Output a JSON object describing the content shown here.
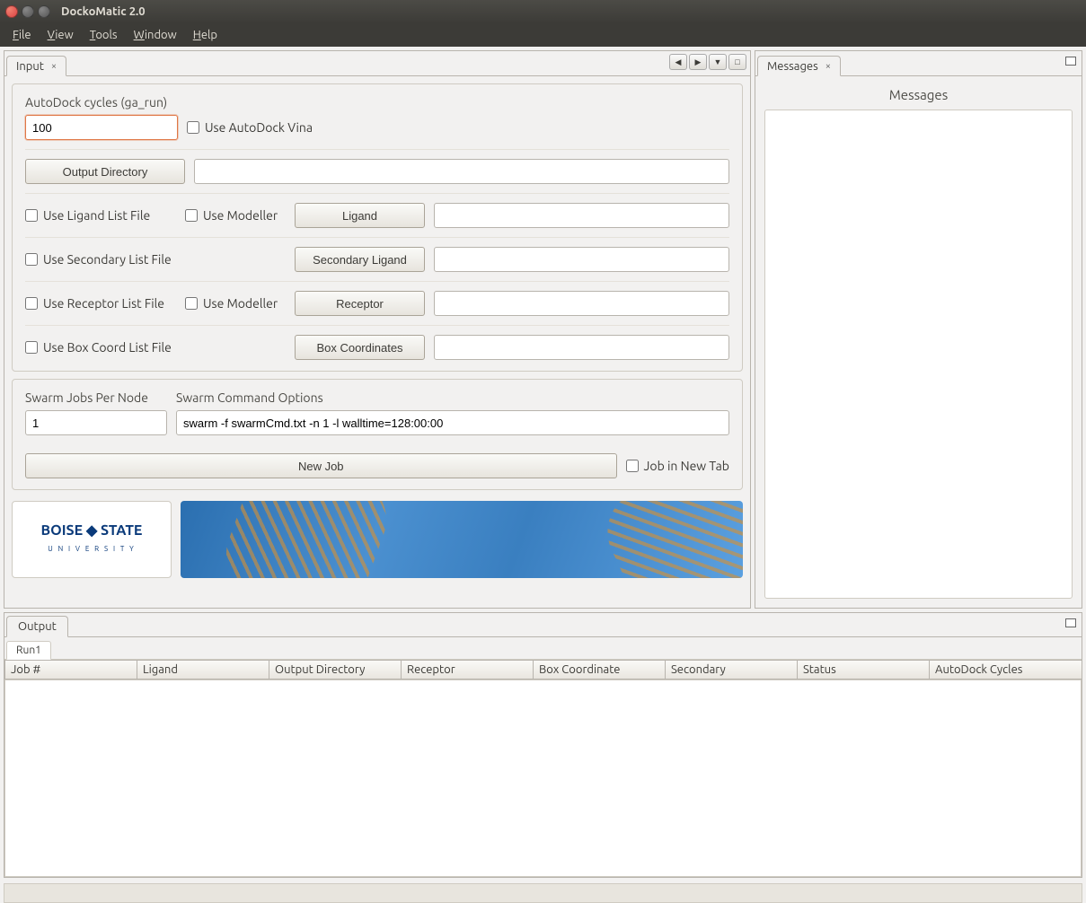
{
  "window": {
    "title": "DockoMatic 2.0"
  },
  "menu": {
    "file": "File",
    "view": "View",
    "tools": "Tools",
    "window": "Window",
    "help": "Help"
  },
  "tabs": {
    "input": "Input",
    "messages": "Messages",
    "output": "Output",
    "run1": "Run1"
  },
  "form": {
    "autodock_label": "AutoDock cycles  (ga_run)",
    "autodock_value": "100",
    "use_vina": "Use AutoDock Vina",
    "output_dir_btn": "Output Directory",
    "output_dir_val": "",
    "use_ligand_list": "Use Ligand List File",
    "use_modeller": "Use Modeller",
    "ligand_btn": "Ligand",
    "ligand_val": "",
    "use_secondary_list": "Use Secondary List File",
    "secondary_btn": "Secondary Ligand",
    "secondary_val": "",
    "use_receptor_list": "Use Receptor List File",
    "use_modeller2": "Use Modeller",
    "receptor_btn": "Receptor",
    "receptor_val": "",
    "use_box_list": "Use Box Coord List File",
    "box_btn": "Box Coordinates",
    "box_val": ""
  },
  "swarm": {
    "jobs_label": "Swarm Jobs Per Node",
    "jobs_val": "1",
    "cmd_label": "Swarm Command Options",
    "cmd_val": "swarm -f swarmCmd.txt -n 1 -l walltime=128:00:00",
    "new_job_btn": "New Job",
    "job_new_tab": "Job in New Tab"
  },
  "messages": {
    "title": "Messages"
  },
  "logo": {
    "line1": "BOISE ◆ STATE",
    "line2": "U N I V E R S I T Y"
  },
  "columns": {
    "c0": "Job #",
    "c1": "Ligand",
    "c2": "Output Directory",
    "c3": "Receptor",
    "c4": "Box Coordinate",
    "c5": "Secondary",
    "c6": "Status",
    "c7": "AutoDock Cycles"
  }
}
